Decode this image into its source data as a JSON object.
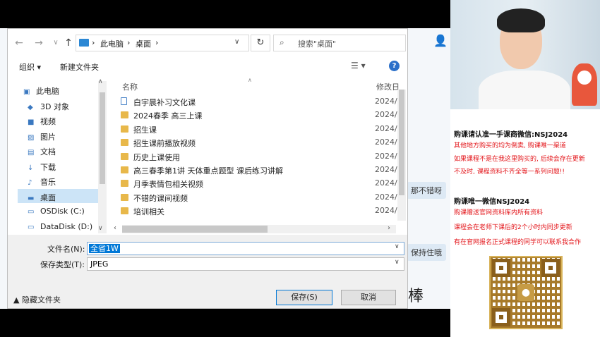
{
  "address": {
    "crumbs": [
      "此电脑",
      "桌面"
    ],
    "search_placeholder": "搜索\"桌面\""
  },
  "toolbar": {
    "organize": "组织 ▾",
    "new_folder": "新建文件夹",
    "help": "?"
  },
  "nav": {
    "items": [
      {
        "label": "此电脑",
        "icon": "computer-icon"
      },
      {
        "label": "3D 对象",
        "icon": "3d-objects-icon"
      },
      {
        "label": "视频",
        "icon": "video-icon"
      },
      {
        "label": "图片",
        "icon": "pictures-icon"
      },
      {
        "label": "文档",
        "icon": "documents-icon"
      },
      {
        "label": "下载",
        "icon": "download-icon"
      },
      {
        "label": "音乐",
        "icon": "music-icon"
      },
      {
        "label": "桌面",
        "icon": "desktop-icon"
      },
      {
        "label": "OSDisk (C:)",
        "icon": "drive-icon"
      },
      {
        "label": "DataDisk (D:)",
        "icon": "drive-icon"
      }
    ],
    "selected": "桌面"
  },
  "files": {
    "col_name": "名称",
    "col_date": "修改日",
    "rows": [
      {
        "name": "白宇晨补习文化课",
        "date": "2024/",
        "type": "doc"
      },
      {
        "name": "2024春季 高三上课",
        "date": "2024/",
        "type": "folder"
      },
      {
        "name": "招生课",
        "date": "2024/",
        "type": "folder"
      },
      {
        "name": "招生课前播放视频",
        "date": "2024/",
        "type": "folder"
      },
      {
        "name": "历史上课使用",
        "date": "2024/",
        "type": "folder"
      },
      {
        "name": "高三春季第1讲 天体重点题型 课后练习讲解",
        "date": "2024/",
        "type": "folder"
      },
      {
        "name": "月季表情包相关视频",
        "date": "2024/",
        "type": "folder"
      },
      {
        "name": "不错的课间视频",
        "date": "2024/",
        "type": "folder"
      },
      {
        "name": "培训相关",
        "date": "2024/",
        "type": "folder"
      }
    ]
  },
  "form": {
    "filename_label": "文件名(N):",
    "filename_value": "全省1W",
    "filetype_label": "保存类型(T):",
    "filetype_value": "JPEG",
    "hide_folders": "隐藏文件夹",
    "save": "保存(S)",
    "cancel": "取消"
  },
  "background": {
    "chip1": "那不错呀",
    "chip2": "保持住哦",
    "char": "棒"
  },
  "promo": {
    "line1": "购课请认准一手课商微信:NSJ2024",
    "line2": "其他地方购买的均为倒卖, 购课唯一渠道",
    "line3": "如果课程不是在我这里购买的, 后续会存在更新",
    "line4": "不及时, 课程资料不齐全等一系列问题!!",
    "line5": "购课唯一微信NSJ2024",
    "line6": "购课赠送官网资料库内所有资料",
    "line7": "课程会在老师下课后的2个小时内同步更新",
    "line8": "有在官网报名正式课程的同学可以联系我合作"
  },
  "colors": {
    "accent": "#0078d7",
    "promo_red": "#e3151a",
    "qr_gold": "#a77a2a"
  }
}
